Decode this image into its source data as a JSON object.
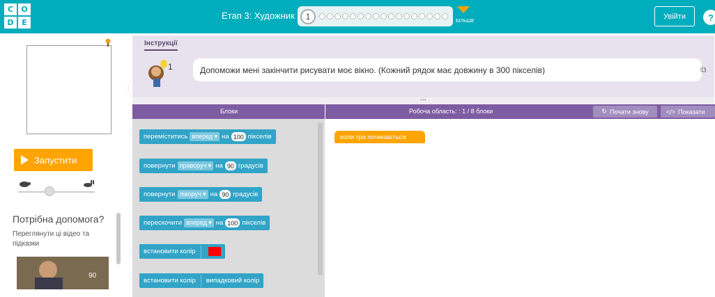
{
  "header": {
    "logo_letters": [
      "C",
      "O",
      "D",
      "E"
    ],
    "stage_title": "Етап 3: Художник",
    "current_level": "1",
    "more_label": "БІЛЬШЕ",
    "signin_label": "Увійти",
    "help_label": "?"
  },
  "left_panel": {
    "run_label": "Запустити",
    "help_title": "Потрібна допомога?",
    "help_subtitle": "Переглянути ці відео та підказки",
    "video_number": "90"
  },
  "instructions": {
    "tab_label": "Інструкції",
    "text": "Допоможи мені закінчити рисувати моє вікно. (Кожний рядок має довжину в 300 пікселів)",
    "level_badge": "1"
  },
  "workspace": {
    "blocks_label": "Блоки",
    "area_label": "Робоча область: : 1 / 8 блоки",
    "restart_label": "Почати знову",
    "show_code_label": "Показати"
  },
  "toolbox": {
    "move": {
      "prefix": "переміститись",
      "dir": "вперед ▾",
      "mid": "на",
      "value": "100",
      "suffix": "пікселів"
    },
    "turn_right": {
      "prefix": "повернути",
      "dir": "праворуч ▾",
      "mid": "на",
      "value": "90",
      "suffix": "градусів"
    },
    "turn_left": {
      "prefix": "повернути",
      "dir": "ліворуч ▾",
      "mid": "на",
      "value": "90",
      "suffix": "градусів"
    },
    "jump": {
      "prefix": "перескочити",
      "dir": "вперед ▾",
      "mid": "на",
      "value": "100",
      "suffix": "пікселів"
    },
    "set_color": {
      "label": "встановити колір",
      "color": "#ff0000"
    },
    "set_color_random": {
      "label": "встановити колір",
      "value": "випадковий колір"
    }
  },
  "program": {
    "start_block": "коли гра починається"
  },
  "colors": {
    "header": "#00adbc",
    "run_button": "#ffa400",
    "block": "#31a4c7",
    "workspace_header": "#7e5ca2"
  }
}
